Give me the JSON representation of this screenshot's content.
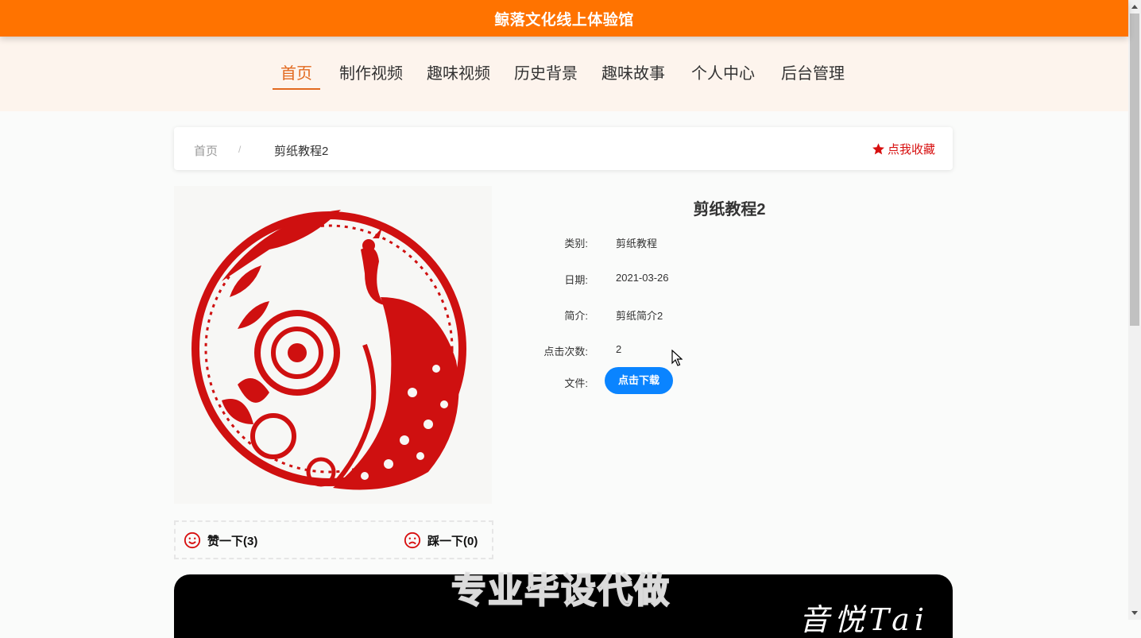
{
  "header": {
    "title": "鲸落文化线上体验馆",
    "bg_color": "#ff7300"
  },
  "nav": {
    "items": [
      {
        "label": "首页",
        "active": true
      },
      {
        "label": "制作视频"
      },
      {
        "label": "趣味视频"
      },
      {
        "label": "历史背景"
      },
      {
        "label": "趣味故事"
      },
      {
        "label": "个人中心"
      },
      {
        "label": "后台管理"
      }
    ],
    "active_color": "#e2691f"
  },
  "breadcrumb": {
    "home": "首页",
    "separator": "/",
    "current": "剪纸教程2"
  },
  "favorite": {
    "label": "点我收藏",
    "icon": "star-icon",
    "color": "#d70f0f"
  },
  "image": {
    "description_icon": "papercut-peacock-image"
  },
  "votes": {
    "like": {
      "label": "赞一下(3)",
      "icon": "smile-icon"
    },
    "dislike": {
      "label": "踩一下(0)",
      "icon": "frown-icon"
    }
  },
  "detail": {
    "title": "剪纸教程2",
    "rows": [
      {
        "label": "类别:",
        "value": "剪纸教程"
      },
      {
        "label": "日期:",
        "value": "2021-03-26"
      },
      {
        "label": "简介:",
        "value": "剪纸简介2"
      },
      {
        "label": "点击次数:",
        "value": "2"
      },
      {
        "label": "文件:",
        "value": ""
      }
    ],
    "download_label": "点击下载",
    "download_color": "#0a84ff"
  },
  "banner": {
    "script_text": "音悦Tai"
  },
  "watermark": "专业毕设代做"
}
